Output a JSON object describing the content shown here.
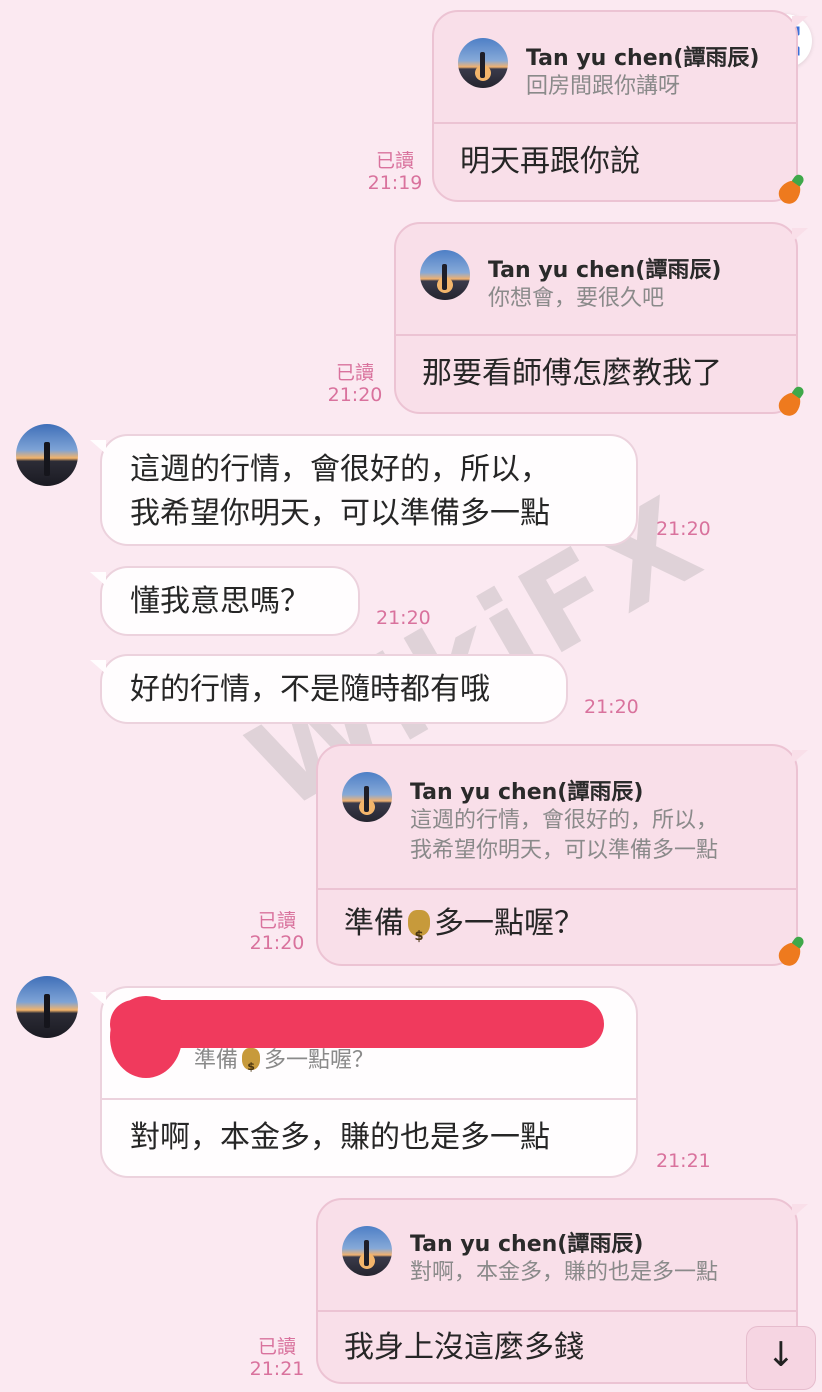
{
  "contact_name": "Tan yu chen(譚雨辰)",
  "read_label": "已讀",
  "watermark_text": "WikiFX",
  "icons": {
    "lens": "lens-icon",
    "scroll_down": "arrow-down-icon",
    "carrot": "carrot-sticker-icon",
    "money_bag": "money-bag-emoji"
  },
  "colors": {
    "background": "#fbe9f1",
    "outgoing_bubble": "#f9dfe9",
    "incoming_bubble": "#fffdfe",
    "status_pink": "#d9729d",
    "redaction": "#f03a5d"
  },
  "scroll_button": {
    "glyph": "↓"
  },
  "messages": [
    {
      "dir": "out",
      "reply_name": "Tan yu chen(譚雨辰)",
      "reply_text": "回房間跟你講呀",
      "text": "明天再跟你說",
      "status": "已讀",
      "time": "21:19"
    },
    {
      "dir": "out",
      "reply_name": "Tan yu chen(譚雨辰)",
      "reply_text": "你想會，要很久吧",
      "text": "那要看師傅怎麼教我了",
      "status": "已讀",
      "time": "21:20"
    },
    {
      "dir": "in",
      "lines": [
        "這週的行情，會很好的，所以，",
        "我希望你明天，可以準備多一點"
      ],
      "time": "21:20"
    },
    {
      "dir": "in",
      "text": "懂我意思嗎？",
      "time": "21:20"
    },
    {
      "dir": "in",
      "text": "好的行情，不是隨時都有哦",
      "time": "21:20"
    },
    {
      "dir": "out",
      "reply_name": "Tan yu chen(譚雨辰)",
      "reply_lines": [
        "這週的行情，會很好的，所以，",
        "我希望你明天，可以準備多一點"
      ],
      "text_before": "準備",
      "text_after": "多一點喔？",
      "status": "已讀",
      "time": "21:20"
    },
    {
      "dir": "in",
      "reply_before": "準備",
      "reply_after": "多一點喔？",
      "text": "對啊，本金多，賺的也是多一點",
      "time": "21:21"
    },
    {
      "dir": "out",
      "reply_name": "Tan yu chen(譚雨辰)",
      "reply_text": "對啊，本金多，賺的也是多一點",
      "text": "我身上沒這麼多錢",
      "status": "已讀",
      "time": "21:21"
    }
  ]
}
